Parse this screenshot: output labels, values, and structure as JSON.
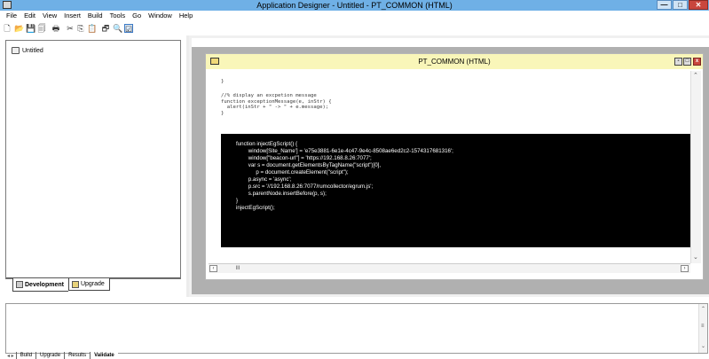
{
  "window": {
    "title": "Application Designer - Untitled - PT_COMMON (HTML)",
    "min": "—",
    "max": "□",
    "close": "✕"
  },
  "menu": [
    "File",
    "Edit",
    "View",
    "Insert",
    "Build",
    "Tools",
    "Go",
    "Window",
    "Help"
  ],
  "toolbar": {
    "icons": [
      "new-icon",
      "open-icon",
      "save-icon",
      "save-all-icon",
      "print-icon",
      "cut-icon",
      "copy-icon",
      "paste-icon",
      "project-icon",
      "find-icon",
      "validate-icon"
    ],
    "glyphs": [
      "🗋",
      "📂",
      "💾",
      "🗐",
      "🖶",
      "✂",
      "⎘",
      "📋",
      "🗗",
      "🔍",
      "☑"
    ]
  },
  "project": {
    "tree_root": "Untitled",
    "tabs": [
      "Development",
      "Upgrade"
    ]
  },
  "editor": {
    "title": "PT_COMMON (HTML)",
    "min": "-",
    "max": "□",
    "close": "x",
    "code_lines": [
      "}",
      "",
      "//% display an excpetion message",
      "function exceptionMessage(e, inStr) {",
      "  alert(inStr + \" -> \" + e.message);",
      "}"
    ],
    "injected_lines": [
      "function injectEgScript() {",
      "        window[Site_Name'] = 'e75e3881-6e1e-4c47-9e4c-8508ae6ed2c2-1574317681316';",
      "        window[\"beacon-url\"] = 'https://192.168.8.26:7077';",
      "        var s = document.getElementsByTagName(\"script\")[0],",
      "             p = document.createElement(\"script\");",
      "        p.async = 'async';",
      "        p.src = '//192.168.8.26:7077/rumcollector/egrum.js';",
      "        s.parentNode.insertBefore(p, s);",
      "}",
      "injectEgScript();"
    ],
    "hscroll_thumb": "III"
  },
  "output": {
    "tabs": [
      "Build",
      "Upgrade",
      "Results",
      "Validate"
    ],
    "active_tab": "Validate",
    "nav": "◂ ▸"
  }
}
